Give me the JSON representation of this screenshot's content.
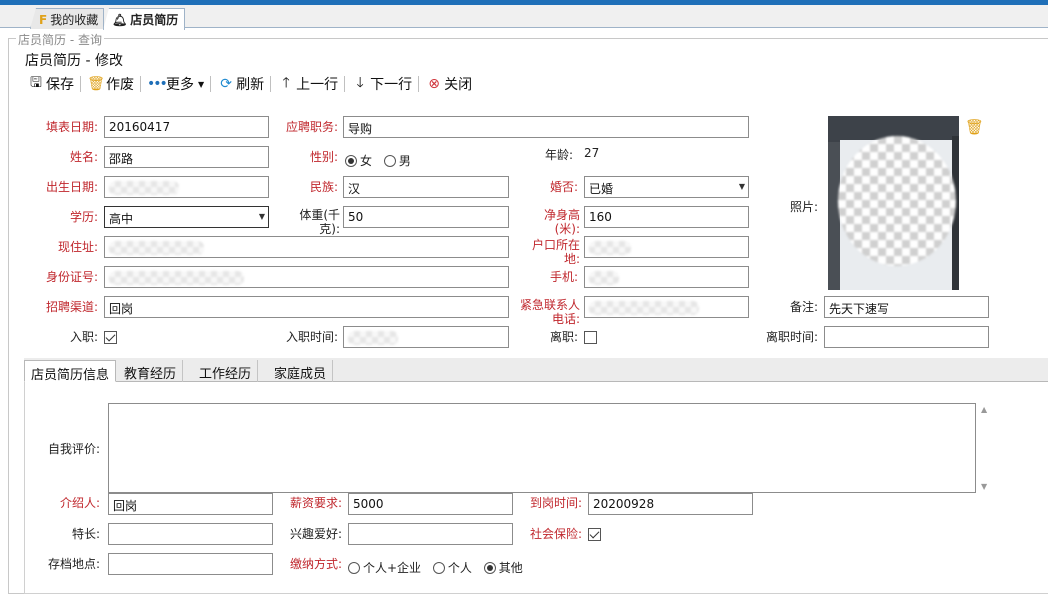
{
  "tabs": [
    {
      "label": "我的收藏",
      "icon": "favorite-icon",
      "active": false
    },
    {
      "label": "店员简历",
      "icon": "bell-icon",
      "active": true
    }
  ],
  "breadcrumb": "店员简历 - 查询",
  "form_title": "店员简历 - 修改",
  "toolbar": {
    "save": "保存",
    "void": "作废",
    "more": "更多",
    "refresh": "刷新",
    "prev": "上一行",
    "next": "下一行",
    "close": "关闭"
  },
  "fields": {
    "fill_date": {
      "label": "填表日期:",
      "value": "20160417"
    },
    "position": {
      "label": "应聘职务:",
      "value": "导购"
    },
    "name": {
      "label": "姓名:",
      "value": "邵路"
    },
    "gender": {
      "label": "性别:",
      "options": [
        "女",
        "男"
      ],
      "selected": "女"
    },
    "age": {
      "label": "年龄:",
      "value": "27"
    },
    "birth_date": {
      "label": "出生日期:",
      "value": ""
    },
    "ethnicity": {
      "label": "民族:",
      "value": "汉"
    },
    "marital": {
      "label": "婚否:",
      "value": "已婚"
    },
    "education": {
      "label": "学历:",
      "value": "高中"
    },
    "weight": {
      "label": "体重(千克):",
      "value": "50"
    },
    "height": {
      "label": "净身高(米):",
      "value": "160"
    },
    "address": {
      "label": "现住址:",
      "value": ""
    },
    "hukou": {
      "label": "户口所在地:",
      "value": ""
    },
    "id_number": {
      "label": "身份证号:",
      "value": ""
    },
    "mobile": {
      "label": "手机:",
      "value": ""
    },
    "channel": {
      "label": "招聘渠道:",
      "value": "回岗"
    },
    "emergency_phone": {
      "label": "紧急联系人电话:",
      "value": ""
    },
    "remark": {
      "label": "备注:",
      "value": "先天下速写"
    },
    "hired": {
      "label": "入职:",
      "checked": true
    },
    "hire_time": {
      "label": "入职时间:",
      "value": ""
    },
    "resigned": {
      "label": "离职:",
      "checked": false
    },
    "resign_time": {
      "label": "离职时间:",
      "value": ""
    },
    "photo": {
      "label": "照片:"
    }
  },
  "subtabs": [
    "店员简历信息",
    "教育经历",
    "工作经历",
    "家庭成员"
  ],
  "detail": {
    "self_eval": {
      "label": "自我评价:",
      "value": ""
    },
    "referrer": {
      "label": "介绍人:",
      "value": "回岗"
    },
    "salary": {
      "label": "薪资要求:",
      "value": "5000"
    },
    "arrival_time": {
      "label": "到岗时间:",
      "value": "20200928"
    },
    "specialty": {
      "label": "特长:",
      "value": ""
    },
    "hobby": {
      "label": "兴趣爱好:",
      "value": ""
    },
    "social_insurance": {
      "label": "社会保险:",
      "checked": true
    },
    "archive_location": {
      "label": "存档地点:",
      "value": ""
    },
    "payment_method": {
      "label": "缴纳方式:",
      "options": [
        "个人+企业",
        "个人",
        "其他"
      ],
      "selected": "其他"
    }
  },
  "colors": {
    "required_label": "#c0272d",
    "accent_bar": "#1f6fb8",
    "trash": "#e0a21a"
  }
}
